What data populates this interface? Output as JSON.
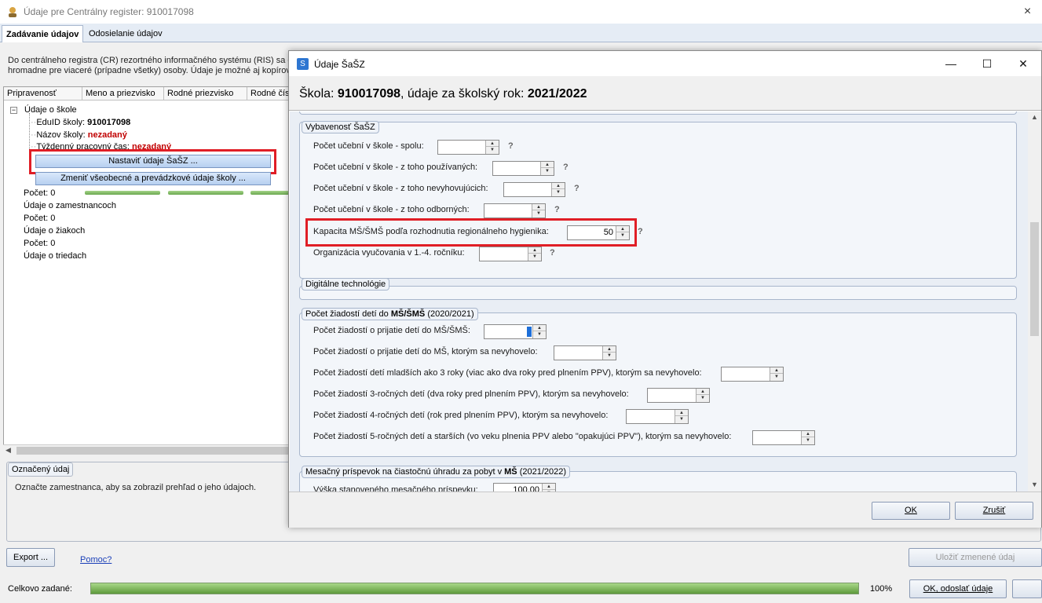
{
  "window": {
    "title": "Údaje pre Centrálny register: 910017098",
    "close": "×"
  },
  "tabs": [
    {
      "label": "Zadávanie údajov"
    },
    {
      "label": "Odosielanie údajov"
    }
  ],
  "description": {
    "line1": "Do centrálneho registra (CR) rezortného informačného systému (RIS) sa o",
    "line2": "hromadne pre viaceré (prípadne všetky) osoby. Údaje je možné aj kopírov"
  },
  "grid": {
    "columns": [
      "Pripravenosť",
      "Meno a priezvisko",
      "Rodné priezvisko",
      "Rodné čís"
    ],
    "tree": {
      "root": "Údaje o škole",
      "eduid_label": "EduID školy:",
      "eduid_value": "910017098",
      "name_label": "Názov školy:",
      "name_value": "nezadaný",
      "hours_label": "Týždenný pracovný čas:",
      "hours_value": "nezadaný",
      "btn_sasz": "Nastaviť údaje ŠaŠZ ...",
      "btn_change": "Zmeniť všeobecné a prevádzkové údaje školy ..."
    },
    "rows": [
      "Počet: 0",
      "Údaje o zamestnancoch",
      "Počet: 0",
      "Údaje o žiakoch",
      "Počet: 0",
      "Údaje o triedach"
    ]
  },
  "selected": {
    "title": "Označený údaj",
    "text": "Označte zamestnanca, aby sa zobrazil prehľad o jeho údajoch."
  },
  "bottom": {
    "export": "Export ...",
    "help": "Pomoc?",
    "save": "Uložiť zmenené údaj",
    "total_label": "Celkovo zadané:",
    "total_pct": "100%",
    "total_value": 1.0,
    "ok_send": "OK, odoslať údaje"
  },
  "dialog": {
    "title": "Údaje ŠaŠZ",
    "controls": {
      "minimize": "—",
      "maximize": "☐",
      "close": "✕"
    },
    "header": {
      "prefix": "Škola: ",
      "school": "910017098",
      "middle": ", údaje za školský rok: ",
      "year": "2021/2022"
    },
    "group1": {
      "title": "Vybavenosť ŠaŠZ",
      "fields": [
        {
          "label": "Počet učební v škole - spolu:",
          "value": ""
        },
        {
          "label": "Počet učební v škole - z toho používaných:",
          "value": ""
        },
        {
          "label": "Počet učební v škole - z toho nevyhovujúcich:",
          "value": ""
        },
        {
          "label": "Počet učební v škole - z toho odborných:",
          "value": ""
        },
        {
          "label": "Kapacita MŠ/ŠMŠ podľa rozhodnutia regionálneho hygienika:",
          "value": "50"
        },
        {
          "label": "Organizácia vyučovania v 1.-4. ročníku:",
          "value": ""
        }
      ]
    },
    "group2": {
      "title": "Digitálne technológie"
    },
    "group3": {
      "title_pre": "Počet žiadostí detí do ",
      "title_bold": "MŠ/ŠMŠ",
      "title_post": " (2020/2021)",
      "fields": [
        {
          "label": "Počet žiadostí o prijatie detí do MŠ/ŠMŠ:",
          "value": ""
        },
        {
          "label": "Počet žiadostí o prijatie detí do MŠ, ktorým sa nevyhovelo:",
          "value": ""
        },
        {
          "label": "Počet žiadostí detí mladších ako 3 roky (viac ako dva roky pred plnením PPV), ktorým sa nevyhovelo:",
          "value": ""
        },
        {
          "label": "Počet žiadostí 3-ročných detí (dva roky pred plnením PPV), ktorým sa nevyhovelo:",
          "value": ""
        },
        {
          "label": "Počet žiadostí 4-ročných detí (rok pred plnením PPV), ktorým sa nevyhovelo:",
          "value": ""
        },
        {
          "label": "Počet žiadostí 5-ročných detí a starších (vo veku plnenia PPV alebo \"opakujúci PPV\"), ktorým sa nevyhovelo:",
          "value": ""
        }
      ]
    },
    "group4": {
      "title_pre": "Mesačný príspevok na čiastočnú úhradu za pobyt v ",
      "title_bold": "MŠ",
      "title_post": " (2021/2022)",
      "fields": [
        {
          "label": "Výška stanoveného mesačného príspevku:",
          "value": "100,00"
        }
      ]
    },
    "help_mark": "?",
    "ok": "OK",
    "cancel": "Zrušiť"
  }
}
